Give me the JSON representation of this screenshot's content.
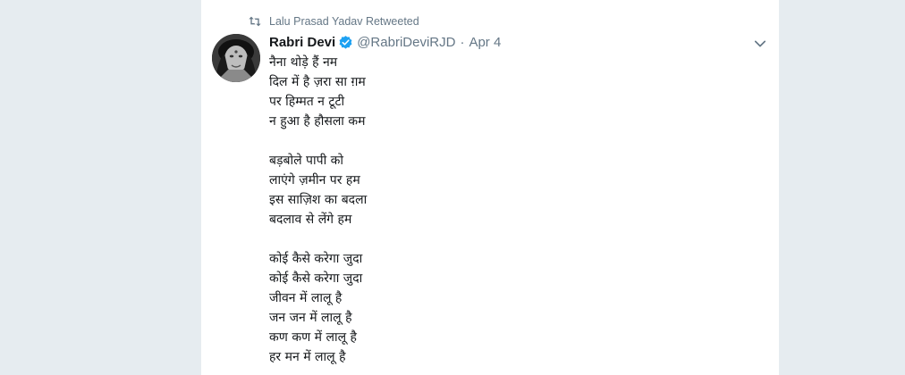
{
  "retweet": {
    "text": "Lalu Prasad Yadav Retweeted",
    "icon": "retweet-icon"
  },
  "author": {
    "name": "Rabri Devi",
    "handle": "@RabriDeviRJD",
    "date": "Apr 4",
    "verified_color": "#1da1f2"
  },
  "tweet": {
    "stanza1": [
      "नैना थोड़े हैं नम",
      "दिल में है ज़रा सा ग़म",
      "पर हिम्मत न टूटी",
      "न हुआ है हौसला कम"
    ],
    "stanza2": [
      "बड़बोले पापी को",
      "लाएंगे ज़मीन पर हम",
      "इस साज़िश का बदला",
      "बदलाव से लेंगे हम"
    ],
    "stanza3": [
      "कोई कैसे करेगा जुदा",
      "कोई कैसे करेगा जुदा",
      "जीवन में लालू है",
      "जन जन में लालू है",
      "कण कण में लालू है",
      "हर मन में लालू है"
    ]
  },
  "colors": {
    "background": "#e6ecf0",
    "secondary_text": "#657786",
    "primary_text": "#14171a",
    "retweet_green": "#657786"
  }
}
